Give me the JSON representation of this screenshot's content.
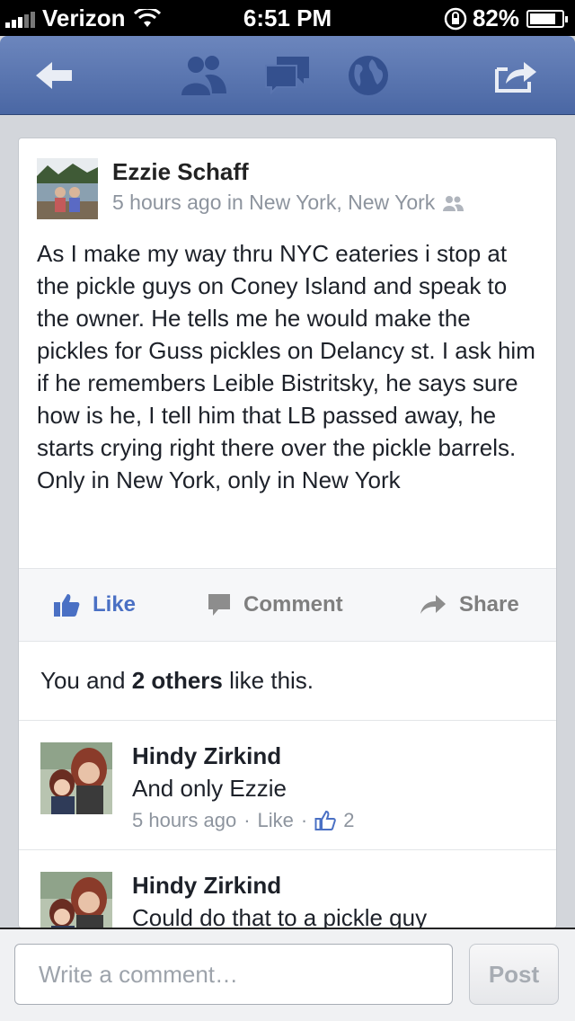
{
  "status_bar": {
    "carrier": "Verizon",
    "time": "6:51 PM",
    "battery": "82%",
    "battery_level": 0.82
  },
  "nav": {
    "icons": [
      "back-arrow-icon",
      "friends-icon",
      "messages-icon",
      "globe-icon",
      "share-out-icon"
    ]
  },
  "post": {
    "author": "Ezzie Schaff",
    "meta": "5 hours ago in New York, New York",
    "text": "As I make my way thru NYC eateries i stop at the pickle guys on Coney Island and speak to the owner. He tells me he would make the pickles for Guss pickles on Delancy st. I ask him if he remembers Leible Bistritsky, he says sure how is he, I tell him that LB passed away, he starts crying right there over the pickle barrels. Only in New York, only in New York"
  },
  "actions": {
    "like": "Like",
    "comment": "Comment",
    "share": "Share"
  },
  "likes": {
    "prefix": "You and",
    "bold": "2 others",
    "suffix": "like this."
  },
  "comments": [
    {
      "name": "Hindy Zirkind",
      "text": "And only Ezzie",
      "time": "5 hours ago",
      "like_label": "Like",
      "like_count": "2"
    },
    {
      "name": "Hindy Zirkind",
      "text": "Could do that to a pickle guy"
    }
  ],
  "composer": {
    "placeholder": "Write a comment…",
    "post_label": "Post"
  },
  "colors": {
    "nav": "#4a67a4",
    "like_blue": "#4a70c4"
  }
}
